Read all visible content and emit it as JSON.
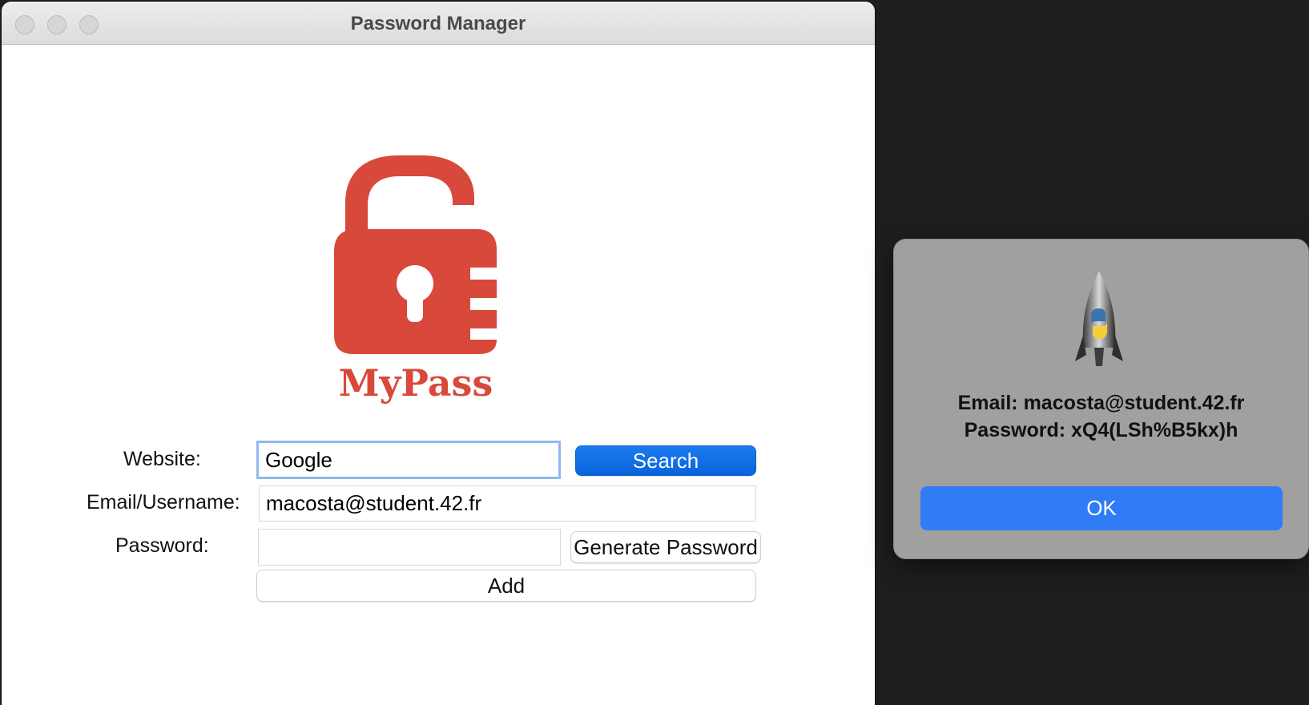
{
  "window": {
    "title": "Password Manager"
  },
  "logo": {
    "text": "MyPass",
    "color": "#d9493b"
  },
  "form": {
    "website_label": "Website:",
    "website_value": "Google",
    "search_label": "Search",
    "email_label": "Email/Username:",
    "email_value": "macosta@student.42.fr",
    "password_label": "Password:",
    "password_value": "",
    "generate_label": "Generate Password",
    "add_label": "Add"
  },
  "dialog": {
    "email_line": "Email: macosta@student.42.fr",
    "password_line": "Password: xQ4(LSh%B5kx)h",
    "ok_label": "OK",
    "icon": "python-launcher-rocket-icon"
  },
  "colors": {
    "accent": "#0a63db",
    "ok_button": "#2f7cf6",
    "dialog_bg": "#a0a09e"
  }
}
